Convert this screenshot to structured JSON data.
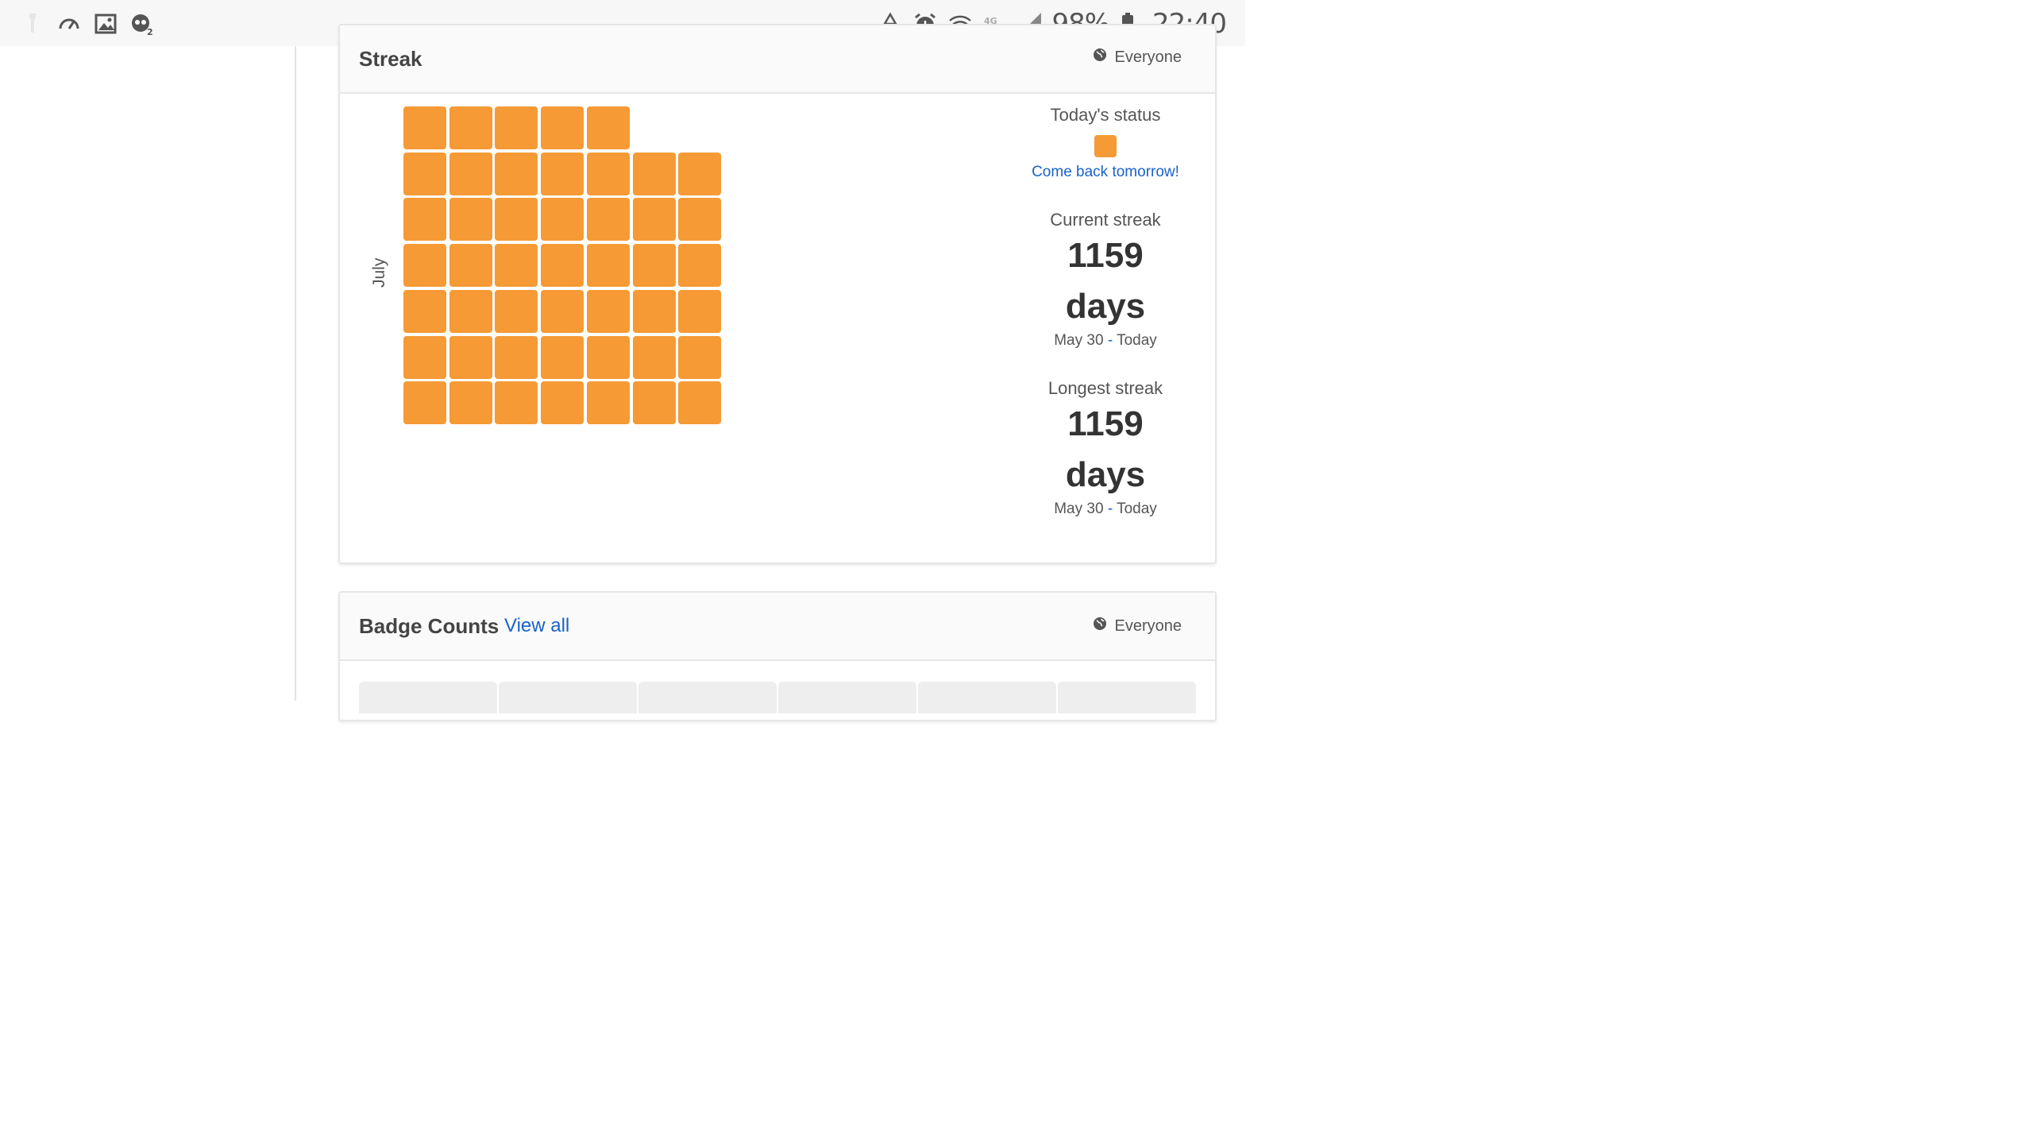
{
  "status_bar": {
    "left_icons": [
      "flashlight-icon",
      "speedometer-icon",
      "gallery-icon",
      "notification-app-icon"
    ],
    "right_icons": [
      "recycle-icon",
      "alarm-icon",
      "wifi-icon",
      "lte-icon",
      "signal-icon"
    ],
    "battery_percent": "98%",
    "time": "22:40"
  },
  "streak_card": {
    "title": "Streak",
    "visibility": "Everyone",
    "month": "July",
    "todays_status_label": "Today's status",
    "status_message": "Come back tomorrow!",
    "current_streak_label": "Current streak",
    "current_streak_number": "1159",
    "current_streak_unit": "days",
    "current_range_start": "May 30",
    "current_range_sep": "-",
    "current_range_end": "Today",
    "longest_streak_label": "Longest streak",
    "longest_streak_number": "1159",
    "longest_streak_unit": "days",
    "longest_range_start": "May 30",
    "longest_range_sep": "-",
    "longest_range_end": "Today",
    "cell_color": "#f59a35",
    "calendar_rows": [
      5,
      7,
      7,
      7,
      7,
      7,
      7
    ]
  },
  "badge_card": {
    "title": "Badge Counts",
    "view_all": "View all",
    "visibility": "Everyone"
  },
  "colors": {
    "accent_link": "#1a63c9",
    "streak_orange": "#f59a35"
  }
}
